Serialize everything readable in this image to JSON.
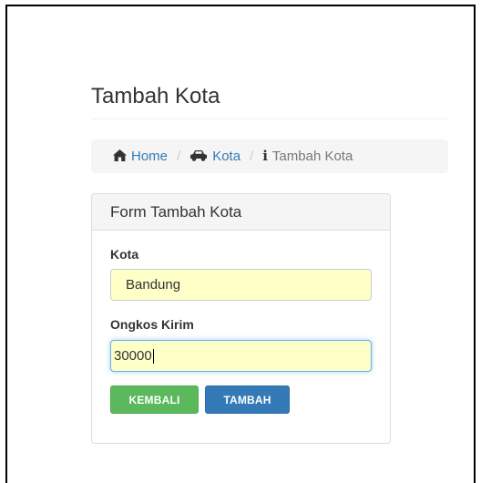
{
  "page": {
    "title": "Tambah Kota"
  },
  "breadcrumb": {
    "home_icon": "home-icon",
    "home_label": "Home",
    "separator": "/",
    "kota_icon": "car-icon",
    "kota_label": "Kota",
    "current_icon": "info-icon",
    "current_label": "Tambah Kota"
  },
  "form": {
    "heading": "Form Tambah Kota",
    "kota_label": "Kota",
    "kota_value": "Bandung",
    "ongkos_label": "Ongkos Kirim",
    "ongkos_value": "30000",
    "back_button": "KEMBALI",
    "add_button": "TAMBAH"
  },
  "colors": {
    "link": "#337ab7",
    "input_bg": "#ffffc8",
    "btn_green": "#5cb85c",
    "btn_blue": "#337ab7"
  }
}
